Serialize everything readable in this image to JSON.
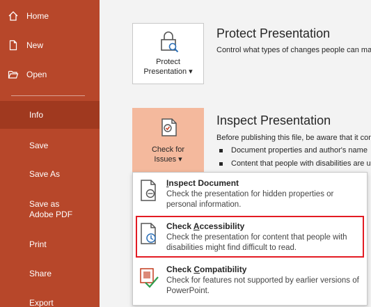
{
  "sidebar": {
    "items": [
      {
        "label": "Home",
        "icon": "home-icon"
      },
      {
        "label": "New",
        "icon": "new-document-icon"
      },
      {
        "label": "Open",
        "icon": "open-folder-icon"
      },
      {
        "label": "Info"
      },
      {
        "label": "Save"
      },
      {
        "label": "Save As"
      },
      {
        "label": "Save as Adobe PDF"
      },
      {
        "label": "Print"
      },
      {
        "label": "Share"
      },
      {
        "label": "Export"
      }
    ],
    "active": "Info"
  },
  "protect": {
    "button_line1": "Protect",
    "button_line2": "Presentation",
    "title": "Protect Presentation",
    "desc": "Control what types of changes people can make to this presentation."
  },
  "inspect": {
    "button_line1": "Check for",
    "button_line2": "Issues",
    "title": "Inspect Presentation",
    "desc": "Before publishing this file, be aware that it contains:",
    "bullets": [
      "Document properties and author's name",
      "Content that people with disabilities are unable to read"
    ]
  },
  "menu": {
    "items": [
      {
        "title_pre": "",
        "title_u": "I",
        "title_post": "nspect Document",
        "desc": "Check the presentation for hidden properties or personal information."
      },
      {
        "title_pre": "Check ",
        "title_u": "A",
        "title_post": "ccessibility",
        "desc": "Check the presentation for content that people with disabilities might find difficult to read."
      },
      {
        "title_pre": "Check ",
        "title_u": "C",
        "title_post": "ompatibility",
        "desc": "Check for features not supported by earlier versions of PowerPoint."
      }
    ]
  },
  "colors": {
    "sidebar": "#b7472a",
    "sidebar_active": "#a0391f",
    "tile_orange": "#f4b99d",
    "highlight": "#e31b23"
  }
}
